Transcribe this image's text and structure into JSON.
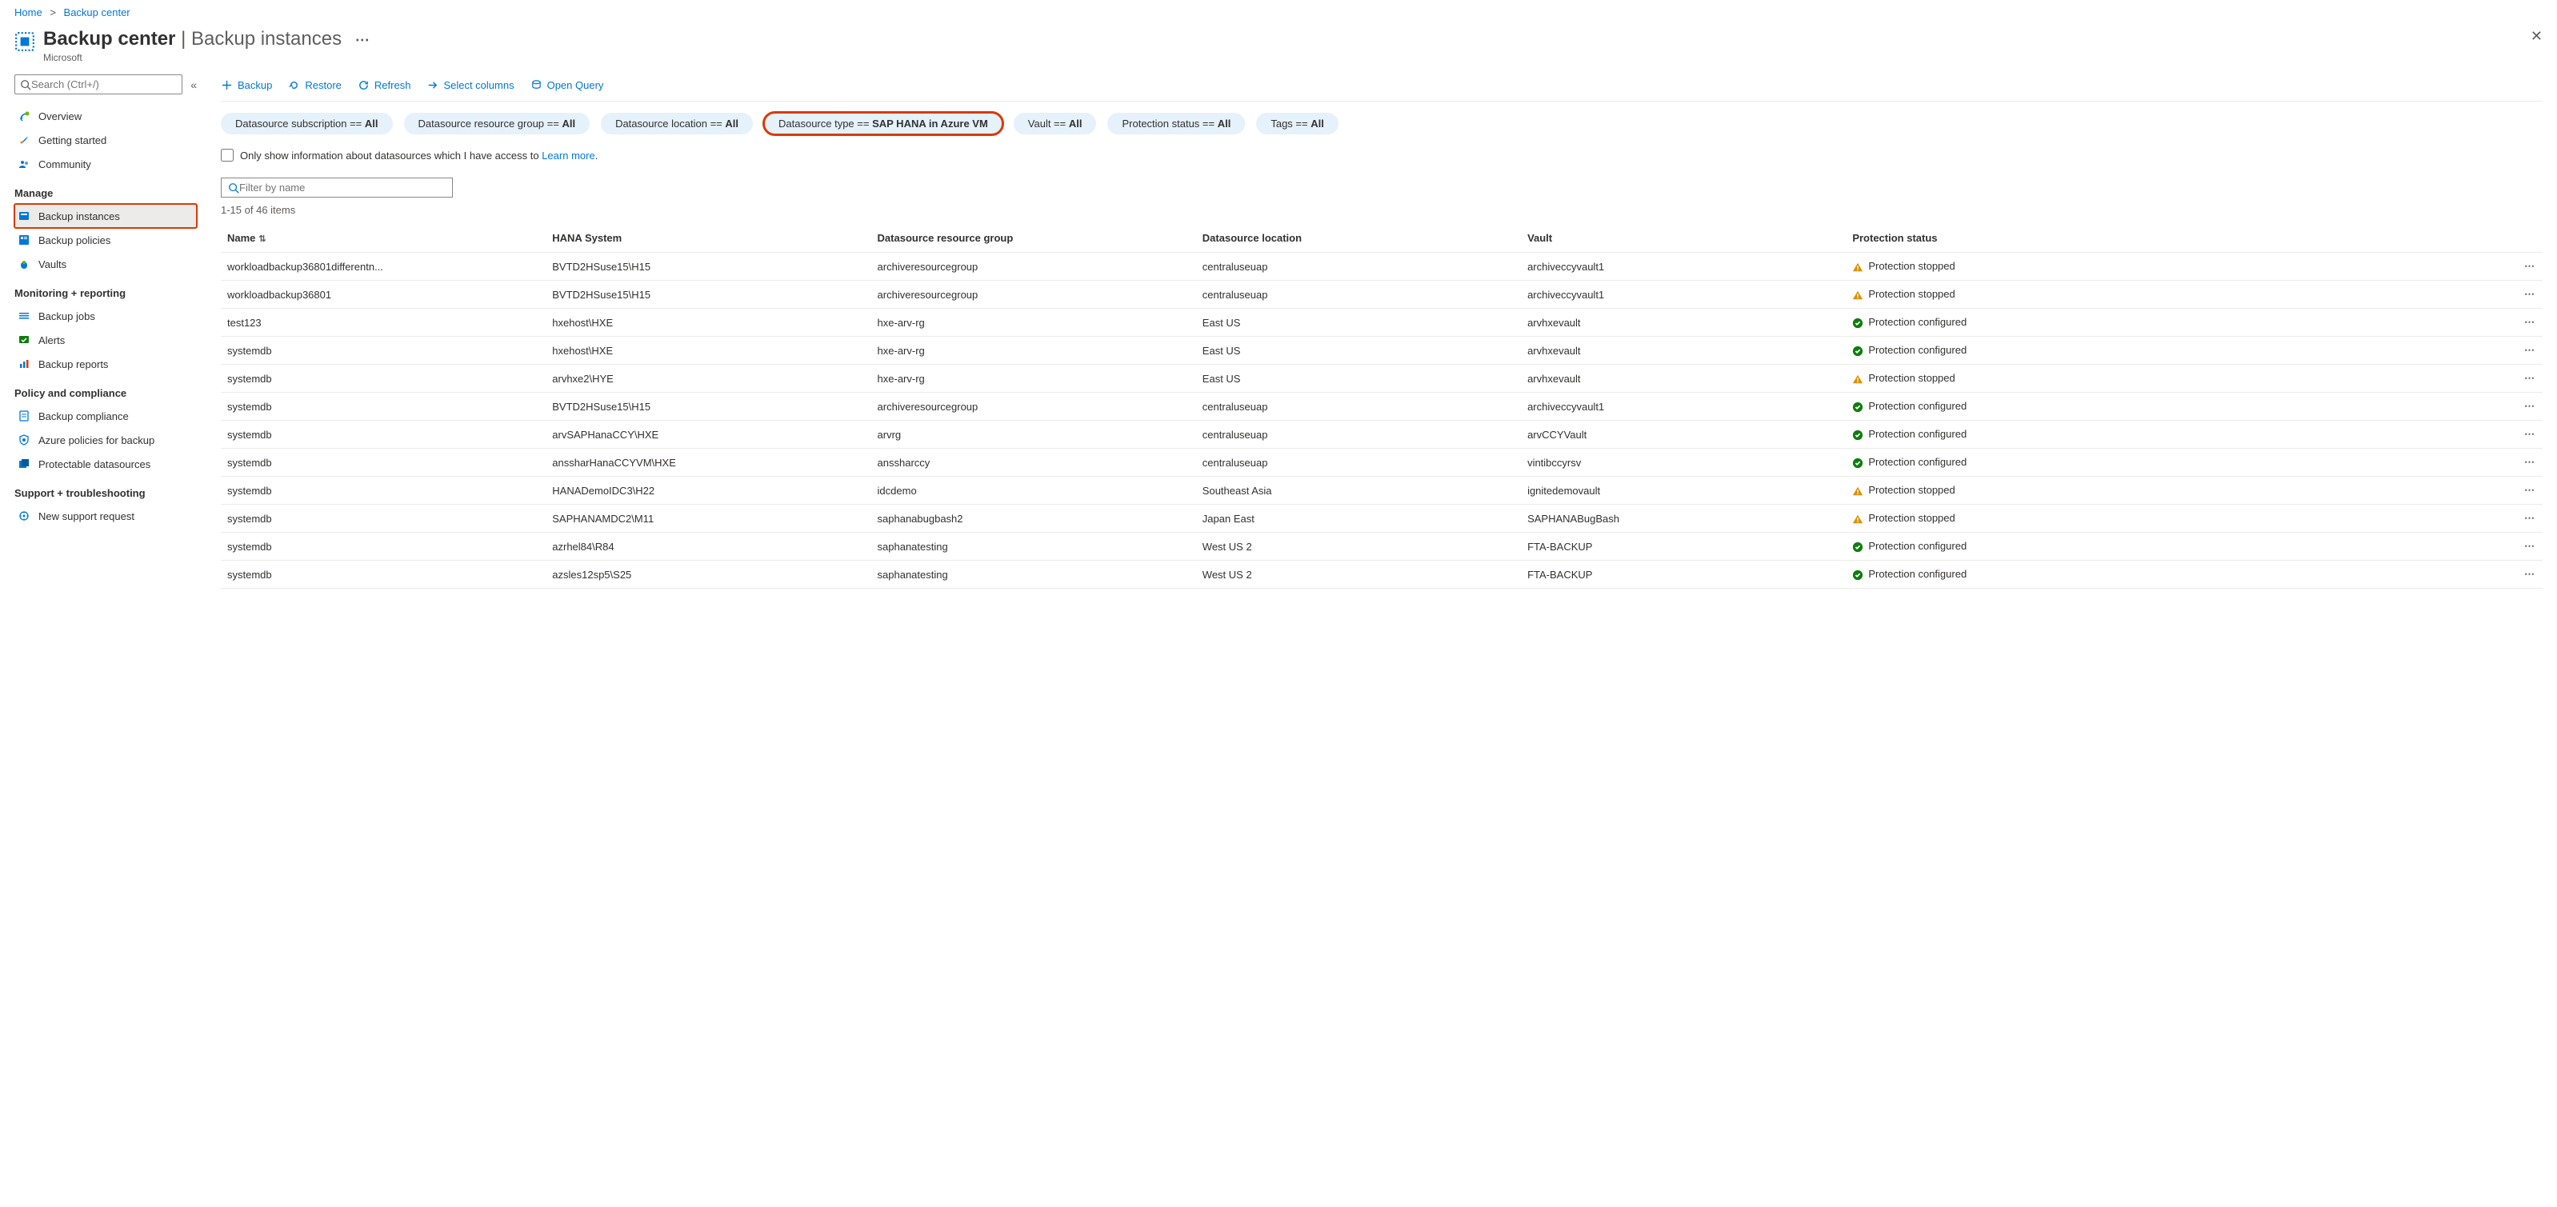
{
  "breadcrumb": {
    "home": "Home",
    "current": "Backup center"
  },
  "header": {
    "title_main": "Backup center",
    "title_sep": " | ",
    "title_sub": "Backup instances",
    "subtitle": "Microsoft"
  },
  "sidebar": {
    "search_placeholder": "Search (Ctrl+/)",
    "top": [
      {
        "id": "overview",
        "label": "Overview"
      },
      {
        "id": "getting-started",
        "label": "Getting started"
      },
      {
        "id": "community",
        "label": "Community"
      }
    ],
    "sections": [
      {
        "title": "Manage",
        "items": [
          {
            "id": "backup-instances",
            "label": "Backup instances",
            "active": true,
            "highlight": true
          },
          {
            "id": "backup-policies",
            "label": "Backup policies"
          },
          {
            "id": "vaults",
            "label": "Vaults"
          }
        ]
      },
      {
        "title": "Monitoring + reporting",
        "items": [
          {
            "id": "backup-jobs",
            "label": "Backup jobs"
          },
          {
            "id": "alerts",
            "label": "Alerts"
          },
          {
            "id": "backup-reports",
            "label": "Backup reports"
          }
        ]
      },
      {
        "title": "Policy and compliance",
        "items": [
          {
            "id": "backup-compliance",
            "label": "Backup compliance"
          },
          {
            "id": "azure-policies",
            "label": "Azure policies for backup"
          },
          {
            "id": "protectable",
            "label": "Protectable datasources"
          }
        ]
      },
      {
        "title": "Support + troubleshooting",
        "items": [
          {
            "id": "new-support",
            "label": "New support request"
          }
        ]
      }
    ]
  },
  "toolbar": {
    "backup": "Backup",
    "restore": "Restore",
    "refresh": "Refresh",
    "columns": "Select columns",
    "open_query": "Open Query"
  },
  "filters": [
    {
      "id": "datasource-subscription",
      "label": "Datasource subscription == ",
      "value": "All"
    },
    {
      "id": "datasource-rg",
      "label": "Datasource resource group == ",
      "value": "All"
    },
    {
      "id": "datasource-location",
      "label": "Datasource location == ",
      "value": "All"
    },
    {
      "id": "datasource-type",
      "label": "Datasource type == ",
      "value": "SAP HANA in Azure VM",
      "highlight": true
    },
    {
      "id": "vault",
      "label": "Vault == ",
      "value": "All"
    },
    {
      "id": "protection-status",
      "label": "Protection status == ",
      "value": "All"
    },
    {
      "id": "tags",
      "label": "Tags == ",
      "value": "All"
    }
  ],
  "access_check": {
    "label": "Only show information about datasources which I have access to ",
    "link": "Learn more"
  },
  "name_filter_placeholder": "Filter by name",
  "count_text": "1-15 of 46 items",
  "columns": {
    "name": "Name",
    "hana": "HANA System",
    "rg": "Datasource resource group",
    "loc": "Datasource location",
    "vault": "Vault",
    "status": "Protection status"
  },
  "rows": [
    {
      "name": "workloadbackup36801differentn...",
      "hana": "BVTD2HSuse15\\H15",
      "rg": "archiveresourcegroup",
      "loc": "centraluseuap",
      "vault": "archiveccyvault1",
      "status": "Protection stopped",
      "stype": "warn"
    },
    {
      "name": "workloadbackup36801",
      "hana": "BVTD2HSuse15\\H15",
      "rg": "archiveresourcegroup",
      "loc": "centraluseuap",
      "vault": "archiveccyvault1",
      "status": "Protection stopped",
      "stype": "warn"
    },
    {
      "name": "test123",
      "hana": "hxehost\\HXE",
      "rg": "hxe-arv-rg",
      "loc": "East US",
      "vault": "arvhxevault",
      "status": "Protection configured",
      "stype": "ok"
    },
    {
      "name": "systemdb",
      "hana": "hxehost\\HXE",
      "rg": "hxe-arv-rg",
      "loc": "East US",
      "vault": "arvhxevault",
      "status": "Protection configured",
      "stype": "ok"
    },
    {
      "name": "systemdb",
      "hana": "arvhxe2\\HYE",
      "rg": "hxe-arv-rg",
      "loc": "East US",
      "vault": "arvhxevault",
      "status": "Protection stopped",
      "stype": "warn"
    },
    {
      "name": "systemdb",
      "hana": "BVTD2HSuse15\\H15",
      "rg": "archiveresourcegroup",
      "loc": "centraluseuap",
      "vault": "archiveccyvault1",
      "status": "Protection configured",
      "stype": "ok"
    },
    {
      "name": "systemdb",
      "hana": "arvSAPHanaCCY\\HXE",
      "rg": "arvrg",
      "loc": "centraluseuap",
      "vault": "arvCCYVault",
      "status": "Protection configured",
      "stype": "ok"
    },
    {
      "name": "systemdb",
      "hana": "anssharHanaCCYVM\\HXE",
      "rg": "anssharccy",
      "loc": "centraluseuap",
      "vault": "vintibccyrsv",
      "status": "Protection configured",
      "stype": "ok"
    },
    {
      "name": "systemdb",
      "hana": "HANADemoIDC3\\H22",
      "rg": "idcdemo",
      "loc": "Southeast Asia",
      "vault": "ignitedemovault",
      "status": "Protection stopped",
      "stype": "warn"
    },
    {
      "name": "systemdb",
      "hana": "SAPHANAMDC2\\M11",
      "rg": "saphanabugbash2",
      "loc": "Japan East",
      "vault": "SAPHANABugBash",
      "status": "Protection stopped",
      "stype": "warn"
    },
    {
      "name": "systemdb",
      "hana": "azrhel84\\R84",
      "rg": "saphanatesting",
      "loc": "West US 2",
      "vault": "FTA-BACKUP",
      "status": "Protection configured",
      "stype": "ok"
    },
    {
      "name": "systemdb",
      "hana": "azsles12sp5\\S25",
      "rg": "saphanatesting",
      "loc": "West US 2",
      "vault": "FTA-BACKUP",
      "status": "Protection configured",
      "stype": "ok"
    }
  ]
}
